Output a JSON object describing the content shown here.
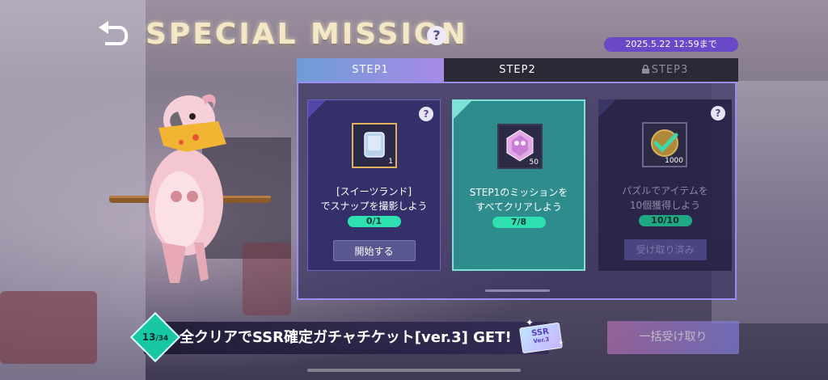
{
  "header": {
    "title": "SPECIAL MISSION",
    "help_symbol": "?",
    "deadline": "2025.5.22 12:59まで"
  },
  "tabs": [
    {
      "label": "STEP1",
      "state": "active"
    },
    {
      "label": "STEP2",
      "state": "normal"
    },
    {
      "label": "STEP3",
      "state": "locked",
      "icon": "lock-icon"
    }
  ],
  "missions": [
    {
      "item_icon": "phone-icon",
      "item_qty": "1",
      "desc_line1": "[スイーツランド]",
      "desc_line2": "でスナップを撮影しよう",
      "progress": "0/1",
      "action": "開始する",
      "help_symbol": "?"
    },
    {
      "item_icon": "crystal-icon",
      "item_qty": "50",
      "desc_line1": "STEP1のミッションを",
      "desc_line2": "すべてクリアしよう",
      "progress": "7/8"
    },
    {
      "item_icon": "coin-check-icon",
      "item_qty": "1000",
      "desc_line1": "パズルでアイテムを",
      "desc_line2": "10個獲得しよう",
      "progress": "10/10",
      "action": "受け取り済み",
      "help_symbol": "?"
    }
  ],
  "bottom": {
    "counter_current": "13",
    "counter_total": "/34",
    "reward_text": "全クリアでSSR確定ガチャチケット[ver.3] GET!",
    "ticket_label": "SSR",
    "ticket_sub": "Ver.3",
    "collect_all": "一括受け取り"
  },
  "colors": {
    "accent_teal": "#2fe0b0",
    "tab_active_gradient": [
      "#6d9dd6",
      "#a88ae6"
    ],
    "panel_border": "#9c8ef0"
  }
}
